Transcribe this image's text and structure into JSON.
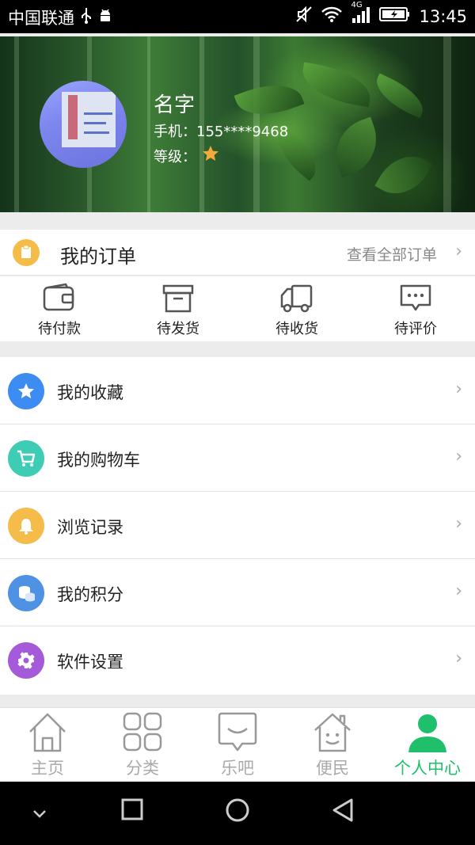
{
  "status_bar": {
    "carrier": "中国联通",
    "network": "4G",
    "time": "13:45"
  },
  "profile": {
    "name": "名字",
    "phone_label": "手机：",
    "phone": "155****9468",
    "level_label": "等级：",
    "stars": 1
  },
  "orders": {
    "title": "我的订单",
    "view_all": "查看全部订单",
    "items": [
      {
        "label": "待付款",
        "icon": "wallet-icon"
      },
      {
        "label": "待发货",
        "icon": "box-icon"
      },
      {
        "label": "待收货",
        "icon": "truck-icon"
      },
      {
        "label": "待评价",
        "icon": "comment-icon"
      }
    ]
  },
  "menu": {
    "items": [
      {
        "label": "我的收藏",
        "icon": "star-icon",
        "color": "#3d8cf2"
      },
      {
        "label": "我的购物车",
        "icon": "cart-icon",
        "color": "#3ecdb4"
      },
      {
        "label": "浏览记录",
        "icon": "bell-icon",
        "color": "#f6bc49"
      },
      {
        "label": "我的积分",
        "icon": "coins-icon",
        "color": "#4f91e3"
      },
      {
        "label": "软件设置",
        "icon": "gear-icon",
        "color": "#a45ad9"
      }
    ]
  },
  "tabbar": {
    "active_color": "#1fbf6c",
    "inactive_color": "#aaaaaa",
    "items": [
      {
        "label": "主页",
        "icon": "home-icon",
        "active": false
      },
      {
        "label": "分类",
        "icon": "grid-icon",
        "active": false
      },
      {
        "label": "乐吧",
        "icon": "chat-bubble-icon",
        "active": false
      },
      {
        "label": "便民",
        "icon": "house-face-icon",
        "active": false
      },
      {
        "label": "个人中心",
        "icon": "person-icon",
        "active": true
      }
    ]
  }
}
